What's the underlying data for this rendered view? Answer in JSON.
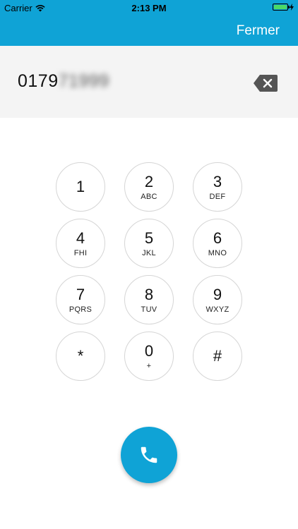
{
  "status_bar": {
    "carrier": "Carrier",
    "time": "2:13 PM",
    "battery_level": 1.0
  },
  "header": {
    "close_label": "Fermer",
    "color": "#0fa3d6"
  },
  "display": {
    "number_visible": "0179",
    "number_hidden": "71999"
  },
  "keypad": {
    "keys": [
      {
        "digit": "1",
        "letters": ""
      },
      {
        "digit": "2",
        "letters": "ABC"
      },
      {
        "digit": "3",
        "letters": "DEF"
      },
      {
        "digit": "4",
        "letters": "FHI"
      },
      {
        "digit": "5",
        "letters": "JKL"
      },
      {
        "digit": "6",
        "letters": "MNO"
      },
      {
        "digit": "7",
        "letters": "PQRS"
      },
      {
        "digit": "8",
        "letters": "TUV"
      },
      {
        "digit": "9",
        "letters": "WXYZ"
      },
      {
        "digit": "*",
        "letters": ""
      },
      {
        "digit": "0",
        "letters": "+"
      },
      {
        "digit": "#",
        "letters": ""
      }
    ]
  },
  "icons": {
    "wifi": "wifi-icon",
    "battery": "battery-icon",
    "charging": "bolt-icon",
    "backspace": "backspace-icon",
    "call": "phone-icon"
  },
  "colors": {
    "accent": "#0fa3d6",
    "battery_fill": "#4cd964",
    "key_border": "#d5d5d5",
    "display_bg": "#f4f4f4",
    "backspace": "#555555"
  }
}
